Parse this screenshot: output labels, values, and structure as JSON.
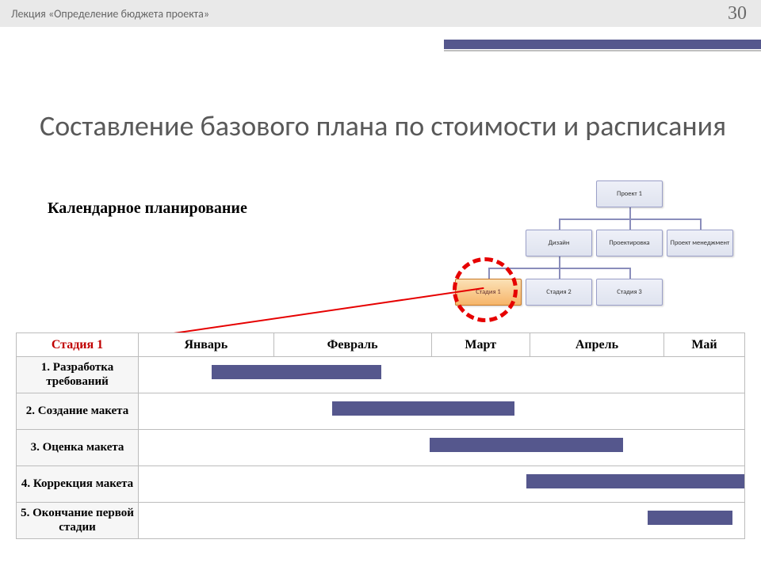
{
  "header": {
    "lecture": "Лекция «Определение бюджета проекта»",
    "slide_number": "30"
  },
  "title": "Составление базового плана по стоимости и расписания",
  "subtitle": "Календарное планирование",
  "hierarchy": {
    "root": "Проект 1",
    "level2": [
      "Дизайн",
      "Проектировка",
      "Проект менеджмент"
    ],
    "level3": [
      "Стадия 1",
      "Стадия 2",
      "Стадия 3"
    ]
  },
  "gantt": {
    "stage_header": "Стадия 1",
    "months": [
      "Январь",
      "Февраль",
      "Март",
      "Апрель",
      "Май"
    ],
    "tasks": [
      "1. Разработка требований",
      "2. Создание макета",
      "3. Оценка макета",
      "4. Коррекция макета",
      "5. Окончание первой стадии"
    ],
    "bars": [
      {
        "row": 0,
        "start_pct": 12,
        "end_pct": 40
      },
      {
        "row": 1,
        "start_pct": 32,
        "end_pct": 62
      },
      {
        "row": 2,
        "start_pct": 48,
        "end_pct": 80
      },
      {
        "row": 3,
        "start_pct": 64,
        "end_pct": 100
      },
      {
        "row": 4,
        "start_pct": 84,
        "end_pct": 98
      }
    ]
  }
}
